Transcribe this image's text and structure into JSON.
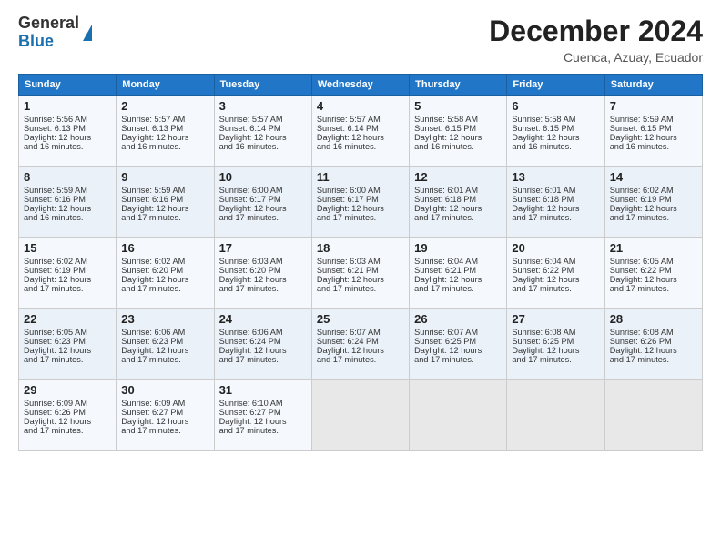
{
  "logo": {
    "line1": "General",
    "line2": "Blue"
  },
  "header": {
    "month": "December 2024",
    "location": "Cuenca, Azuay, Ecuador"
  },
  "days_of_week": [
    "Sunday",
    "Monday",
    "Tuesday",
    "Wednesday",
    "Thursday",
    "Friday",
    "Saturday"
  ],
  "weeks": [
    [
      {
        "day": "1",
        "sunrise": "5:56 AM",
        "sunset": "6:13 PM",
        "daylight": "12 hours and 16 minutes."
      },
      {
        "day": "2",
        "sunrise": "5:57 AM",
        "sunset": "6:13 PM",
        "daylight": "12 hours and 16 minutes."
      },
      {
        "day": "3",
        "sunrise": "5:57 AM",
        "sunset": "6:14 PM",
        "daylight": "12 hours and 16 minutes."
      },
      {
        "day": "4",
        "sunrise": "5:57 AM",
        "sunset": "6:14 PM",
        "daylight": "12 hours and 16 minutes."
      },
      {
        "day": "5",
        "sunrise": "5:58 AM",
        "sunset": "6:15 PM",
        "daylight": "12 hours and 16 minutes."
      },
      {
        "day": "6",
        "sunrise": "5:58 AM",
        "sunset": "6:15 PM",
        "daylight": "12 hours and 16 minutes."
      },
      {
        "day": "7",
        "sunrise": "5:59 AM",
        "sunset": "6:15 PM",
        "daylight": "12 hours and 16 minutes."
      }
    ],
    [
      {
        "day": "8",
        "sunrise": "5:59 AM",
        "sunset": "6:16 PM",
        "daylight": "12 hours and 16 minutes."
      },
      {
        "day": "9",
        "sunrise": "5:59 AM",
        "sunset": "6:16 PM",
        "daylight": "12 hours and 17 minutes."
      },
      {
        "day": "10",
        "sunrise": "6:00 AM",
        "sunset": "6:17 PM",
        "daylight": "12 hours and 17 minutes."
      },
      {
        "day": "11",
        "sunrise": "6:00 AM",
        "sunset": "6:17 PM",
        "daylight": "12 hours and 17 minutes."
      },
      {
        "day": "12",
        "sunrise": "6:01 AM",
        "sunset": "6:18 PM",
        "daylight": "12 hours and 17 minutes."
      },
      {
        "day": "13",
        "sunrise": "6:01 AM",
        "sunset": "6:18 PM",
        "daylight": "12 hours and 17 minutes."
      },
      {
        "day": "14",
        "sunrise": "6:02 AM",
        "sunset": "6:19 PM",
        "daylight": "12 hours and 17 minutes."
      }
    ],
    [
      {
        "day": "15",
        "sunrise": "6:02 AM",
        "sunset": "6:19 PM",
        "daylight": "12 hours and 17 minutes."
      },
      {
        "day": "16",
        "sunrise": "6:02 AM",
        "sunset": "6:20 PM",
        "daylight": "12 hours and 17 minutes."
      },
      {
        "day": "17",
        "sunrise": "6:03 AM",
        "sunset": "6:20 PM",
        "daylight": "12 hours and 17 minutes."
      },
      {
        "day": "18",
        "sunrise": "6:03 AM",
        "sunset": "6:21 PM",
        "daylight": "12 hours and 17 minutes."
      },
      {
        "day": "19",
        "sunrise": "6:04 AM",
        "sunset": "6:21 PM",
        "daylight": "12 hours and 17 minutes."
      },
      {
        "day": "20",
        "sunrise": "6:04 AM",
        "sunset": "6:22 PM",
        "daylight": "12 hours and 17 minutes."
      },
      {
        "day": "21",
        "sunrise": "6:05 AM",
        "sunset": "6:22 PM",
        "daylight": "12 hours and 17 minutes."
      }
    ],
    [
      {
        "day": "22",
        "sunrise": "6:05 AM",
        "sunset": "6:23 PM",
        "daylight": "12 hours and 17 minutes."
      },
      {
        "day": "23",
        "sunrise": "6:06 AM",
        "sunset": "6:23 PM",
        "daylight": "12 hours and 17 minutes."
      },
      {
        "day": "24",
        "sunrise": "6:06 AM",
        "sunset": "6:24 PM",
        "daylight": "12 hours and 17 minutes."
      },
      {
        "day": "25",
        "sunrise": "6:07 AM",
        "sunset": "6:24 PM",
        "daylight": "12 hours and 17 minutes."
      },
      {
        "day": "26",
        "sunrise": "6:07 AM",
        "sunset": "6:25 PM",
        "daylight": "12 hours and 17 minutes."
      },
      {
        "day": "27",
        "sunrise": "6:08 AM",
        "sunset": "6:25 PM",
        "daylight": "12 hours and 17 minutes."
      },
      {
        "day": "28",
        "sunrise": "6:08 AM",
        "sunset": "6:26 PM",
        "daylight": "12 hours and 17 minutes."
      }
    ],
    [
      {
        "day": "29",
        "sunrise": "6:09 AM",
        "sunset": "6:26 PM",
        "daylight": "12 hours and 17 minutes."
      },
      {
        "day": "30",
        "sunrise": "6:09 AM",
        "sunset": "6:27 PM",
        "daylight": "12 hours and 17 minutes."
      },
      {
        "day": "31",
        "sunrise": "6:10 AM",
        "sunset": "6:27 PM",
        "daylight": "12 hours and 17 minutes."
      },
      null,
      null,
      null,
      null
    ]
  ],
  "labels": {
    "sunrise": "Sunrise:",
    "sunset": "Sunset:",
    "daylight": "Daylight:"
  }
}
